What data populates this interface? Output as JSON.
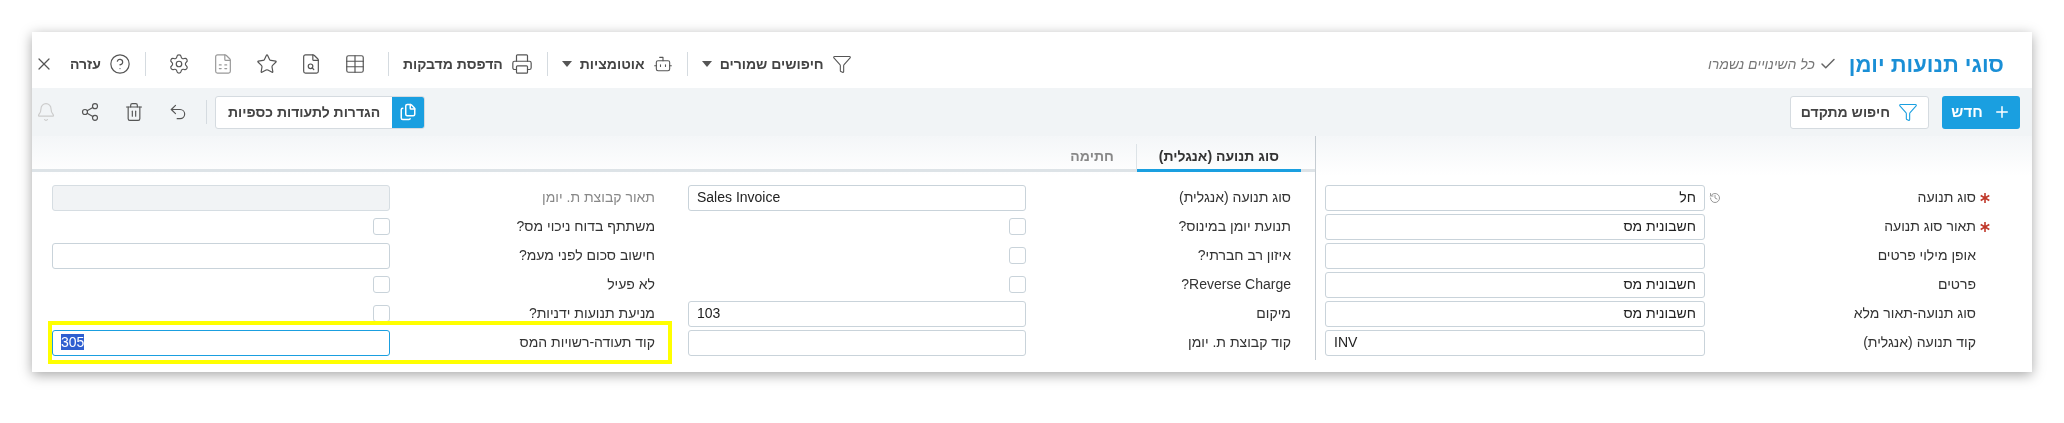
{
  "header": {
    "title": "סוגי תנועות יומן",
    "save_status": "כל השינויים נשמרו"
  },
  "toolbar": {
    "saved_searches": "חיפושים שמורים",
    "automations": "אוטומציות",
    "print_labels": "הדפסת מדבקות",
    "help": "עזרה"
  },
  "actions": {
    "new": "חדש",
    "advanced_search": "חיפוש מתקדם",
    "settings": "הגדרות לתעודות כספיות"
  },
  "main_fields": [
    {
      "label": "סוג תנועה",
      "required": true,
      "kind": "lookup",
      "value": "חל"
    },
    {
      "label": "תאור סוג תנועה",
      "required": true,
      "kind": "text",
      "value": "חשבונית מס"
    },
    {
      "label": "אופן מילוי פרטים",
      "required": false,
      "kind": "text"
    },
    {
      "label": "פרטים",
      "required": false,
      "kind": "text",
      "value": "חשבונית מס"
    },
    {
      "label": "סוג תנועה-תאור מלא",
      "required": false,
      "kind": "text",
      "value": "חשבונית מס"
    },
    {
      "label": "קוד תנועה (אנגלית)",
      "required": false,
      "kind": "text",
      "value": "INV"
    }
  ],
  "tabs": [
    {
      "label": "סוג תנועה (אנגלית)",
      "selected": true
    },
    {
      "label": "חתימה",
      "selected": false
    }
  ],
  "tab_fields": [
    {
      "label": "סוג תנועה (אנגלית)",
      "kind": "text",
      "value": "Sales Invoice"
    },
    {
      "label": "תנועת יומן במינוס?",
      "kind": "checkbox",
      "checked": false
    },
    {
      "label": "איזון רב חברתי?",
      "kind": "checkbox",
      "checked": false
    },
    {
      "label": "Reverse Charge?",
      "kind": "checkbox",
      "checked": false
    },
    {
      "label": "מיקום",
      "kind": "text",
      "value": "103"
    },
    {
      "label": "קוד קבוצת ת. יומן",
      "kind": "text"
    }
  ],
  "tab_fields_2": [
    {
      "label": "תאור קבוצת ת. יומן",
      "kind": "readonly",
      "highlighted": false
    },
    {
      "label": "משתתף בדוח ניכוי מס?",
      "kind": "checkbox",
      "checked": false,
      "highlighted": false
    },
    {
      "label": "חישוב סכום לפני מעמ?",
      "kind": "text",
      "highlighted": false
    },
    {
      "label": "לא פעיל",
      "kind": "checkbox",
      "checked": false,
      "highlighted": false
    },
    {
      "label": "מניעת תנועות ידניות?",
      "kind": "checkbox",
      "checked": false,
      "highlighted": false
    },
    {
      "label": "קוד תעודה-רשויות המס",
      "kind": "text",
      "value": "305",
      "highlighted": true
    }
  ]
}
